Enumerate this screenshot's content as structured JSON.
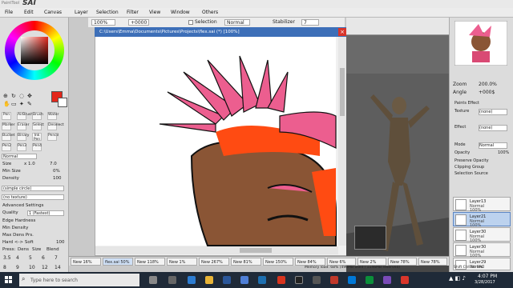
{
  "app": {
    "logo": "SAI",
    "brand": "PaintTool"
  },
  "menu": [
    "File",
    "Edit",
    "Canvas",
    "Layer",
    "Selection",
    "Filter",
    "View",
    "Window",
    "Others"
  ],
  "toolbar": {
    "zoom": "100%",
    "angle": "+0000",
    "selection_label": "Selection",
    "normal_label": "Normal",
    "stabilizer_label": "Stabilizer",
    "stabilizer_value": "7"
  },
  "canvas": {
    "title": "C:\\Users\\Emma\\Documents\\Pictures\\Projects\\flex.sai (*) [100%]"
  },
  "tools": {
    "row1": [
      "Pen",
      "AirBrush",
      "Brush",
      "Water"
    ],
    "row2": [
      "Marker",
      "Eraser",
      "Select",
      "Deselect"
    ],
    "row3": [
      "Bucket",
      "Binary",
      "Ink Pen",
      "Pencil"
    ],
    "row4": [
      "Pen2",
      "Pen3",
      "Pen4"
    ]
  },
  "brush": {
    "mode": "Normal",
    "size_label": "Size",
    "size_mult": "x 1.0",
    "size_value": "7.0",
    "min_size_label": "Min Size",
    "min_size_value": "0%",
    "density_label": "Density",
    "density_value": "100",
    "shape": "(simple circle)",
    "texture": "(no texture)",
    "adv_label": "Advanced Settings",
    "quality_label": "Quality",
    "quality_value": "1 (Fastest)",
    "edge_label": "Edge Hardness",
    "min_density_label": "Min Density",
    "max_dens_label": "Max Dens Prs.",
    "hard_soft_label": "Hard <-> Soft",
    "hard_soft_value": "100",
    "press_label": "Press:",
    "press_opts": [
      "Dens",
      "Size",
      "Blend"
    ],
    "sizes": [
      "3.5",
      "4",
      "5",
      "6",
      "7",
      "8",
      "9",
      "10",
      "12",
      "14"
    ]
  },
  "navigator": {
    "zoom_label": "Zoom",
    "zoom_value": "200.0%",
    "angle_label": "Angle",
    "angle_value": "+000$"
  },
  "layer_props": {
    "effect_header": "Paints Effect",
    "texture_label": "Texture",
    "texture_value": "(none)",
    "effect_label": "Effect",
    "effect_value": "(none)",
    "mode_label": "Mode",
    "mode_value": "Normal",
    "opacity_label": "Opacity",
    "opacity_value": "100%",
    "preserve_opacity": "Preserve Opacity",
    "clipping_group": "Clipping Group",
    "selection_source": "Selection Source"
  },
  "layers": [
    {
      "name": "Layer13",
      "mode": "Normal",
      "opacity": "100%",
      "selected": false
    },
    {
      "name": "Layer21",
      "mode": "Normal",
      "opacity": "100%",
      "selected": true
    },
    {
      "name": "Layer30",
      "mode": "Normal",
      "opacity": "100%",
      "selected": false
    },
    {
      "name": "Layer30",
      "mode": "Normal",
      "opacity": "100%",
      "selected": false
    },
    {
      "name": "Layer29",
      "mode": "Normal",
      "opacity": "100%",
      "selected": false
    }
  ],
  "tabs": [
    {
      "label": "New",
      "pct": "16%"
    },
    {
      "label": "flex.sai",
      "pct": "50%"
    },
    {
      "label": "New",
      "pct": "118%"
    },
    {
      "label": "New",
      "pct": "1%"
    },
    {
      "label": "New",
      "pct": "267%"
    },
    {
      "label": "New",
      "pct": "81%"
    },
    {
      "label": "New",
      "pct": "150%"
    },
    {
      "label": "New",
      "pct": "84%"
    },
    {
      "label": "New",
      "pct": "6%"
    },
    {
      "label": "New",
      "pct": "2%"
    },
    {
      "label": "New",
      "pct": "78%"
    },
    {
      "label": "New",
      "pct": "78%"
    }
  ],
  "status": {
    "memory": "Memory load: 68% (490MB used / 1146MB reserved)",
    "keys": "Shift Ctrl Alt SPC"
  },
  "taskbar": {
    "search": "Type here to search",
    "time": "4:07 PM",
    "date": "3/28/2017"
  },
  "colors": {
    "accent": "#3d6fb8",
    "hair": "#ec5e8f",
    "skin": "#8a5535",
    "primary_color": "#e3271b"
  }
}
